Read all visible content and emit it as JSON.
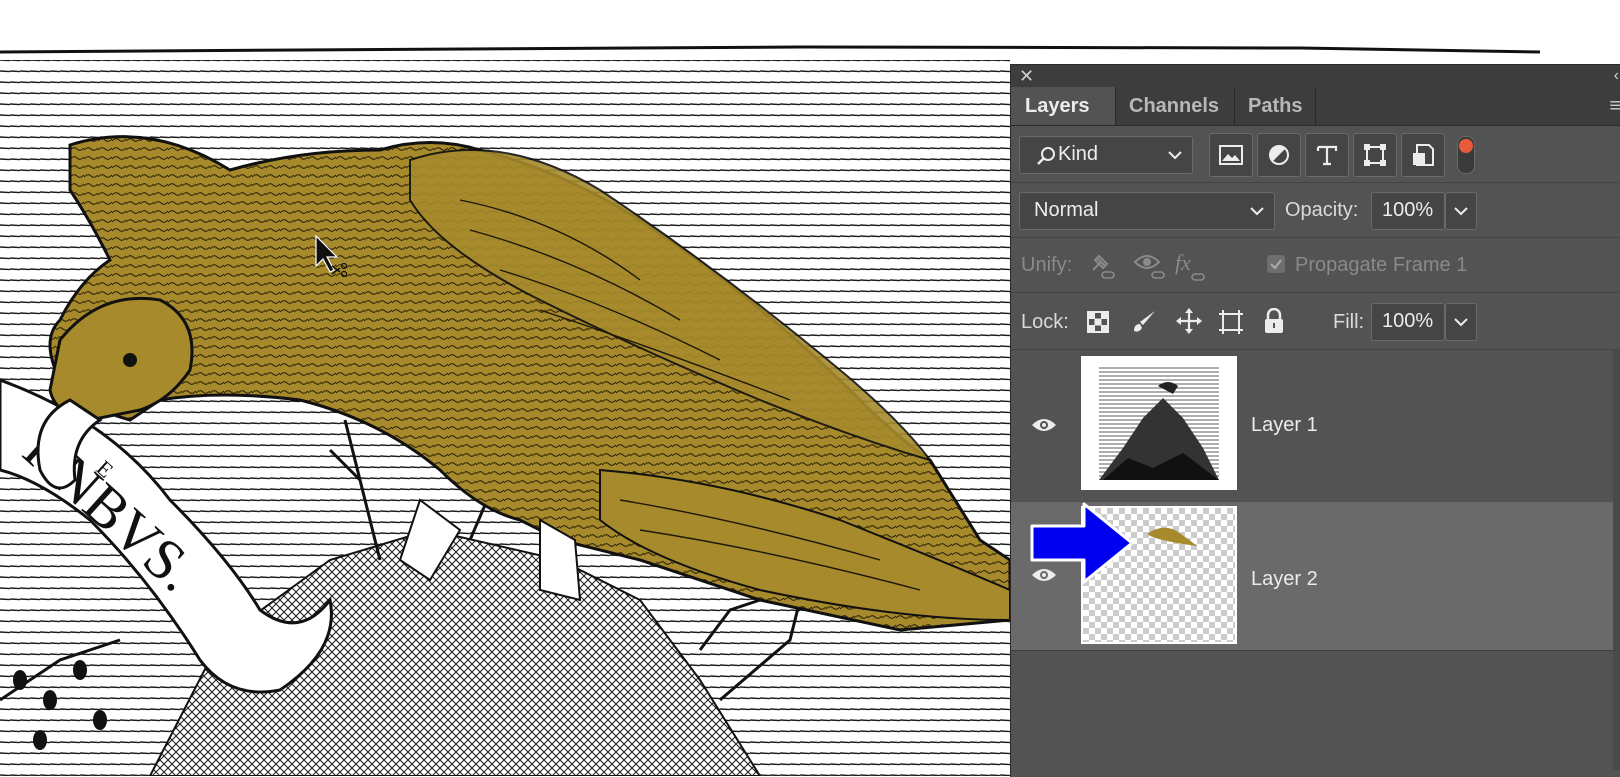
{
  "canvas": {
    "banner_text": "RNBVS.",
    "banner_superscript": "E",
    "fill_color": "#a68a2c"
  },
  "panel": {
    "tabs": [
      {
        "label": "Layers",
        "active": true
      },
      {
        "label": "Channels",
        "active": false
      },
      {
        "label": "Paths",
        "active": false
      }
    ],
    "filter": {
      "kind_label": "Kind",
      "icons": [
        "image-filter-icon",
        "adjustment-filter-icon",
        "type-filter-icon",
        "shape-filter-icon",
        "smart-object-filter-icon"
      ],
      "toggle_color": "#e85a3a"
    },
    "blend_mode": "Normal",
    "opacity_label": "Opacity:",
    "opacity_value": "100%",
    "unify_label": "Unify:",
    "propagate_label": "Propagate Frame 1",
    "lock_label": "Lock:",
    "fill_label": "Fill:",
    "fill_value": "100%",
    "layers": [
      {
        "name": "Layer 1",
        "visible": true,
        "selected": false
      },
      {
        "name": "Layer 2",
        "visible": true,
        "selected": true
      }
    ],
    "annotation_arrow_color": "#0000f0"
  }
}
